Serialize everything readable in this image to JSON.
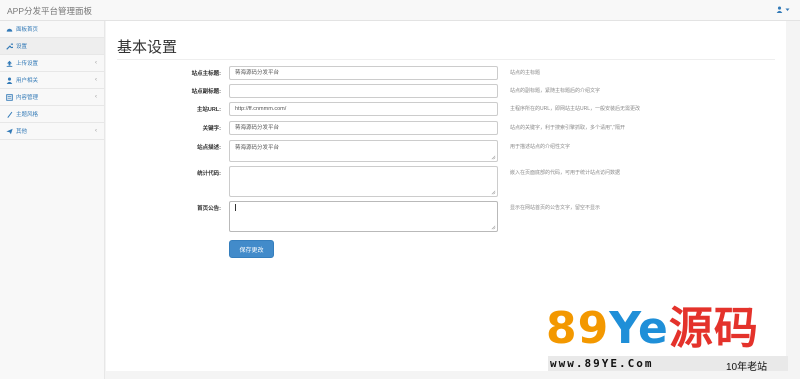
{
  "app": {
    "title": "APP分发平台管理面板"
  },
  "sidebar": {
    "items": [
      {
        "label": "面板首页",
        "icon": "dashboard-icon",
        "has_submenu": false
      },
      {
        "label": "设置",
        "icon": "wrench-icon",
        "has_submenu": false,
        "active": true
      },
      {
        "label": "上传设置",
        "icon": "upload-icon",
        "has_submenu": true
      },
      {
        "label": "用户相关",
        "icon": "user-icon",
        "has_submenu": true
      },
      {
        "label": "内容管理",
        "icon": "content-icon",
        "has_submenu": true
      },
      {
        "label": "主题风格",
        "icon": "theme-icon",
        "has_submenu": false
      },
      {
        "label": "其他",
        "icon": "paper-plane-icon",
        "has_submenu": true
      }
    ],
    "chevron": "‹"
  },
  "main": {
    "title": "基本设置",
    "form": {
      "site_title": {
        "label": "站点主标题:",
        "value": "蒋海源码分发平台",
        "help": "站点的主标题"
      },
      "site_subtitle": {
        "label": "站点副标题:",
        "value": "",
        "help": "站点的副标题，紧随主标题后的介绍文字"
      },
      "main_url": {
        "label": "主站URL:",
        "value": "http://ff.cnmmm.com/",
        "help": "主程序所在的URL，即网站主站URL，一般安装后无需更改"
      },
      "keywords": {
        "label": "关键字:",
        "value": "蒋海源码分发平台",
        "help": "站点的关键字，利于搜索引擎抓取，多个请用\",\"隔开"
      },
      "description": {
        "label": "站点描述:",
        "value": "蒋海源码分发平台",
        "help": "用于描述站点的介绍性文字"
      },
      "stats_code": {
        "label": "统计代码:",
        "value": "",
        "help": "嵌入在页面底部的代码，可用于统计站点访问数据"
      },
      "announcement": {
        "label": "首页公告:",
        "value": "",
        "help": "显示在网站首页的公告文字，留空不显示"
      }
    },
    "save_label": "保存更改"
  },
  "watermark": {
    "big_num": "89",
    "big_y": "Ye",
    "big_cn": "源码",
    "url": "www.89YE.Com",
    "tagline": "10年老站"
  },
  "colors": {
    "accent": "#428bca",
    "link": "#337ab7"
  }
}
